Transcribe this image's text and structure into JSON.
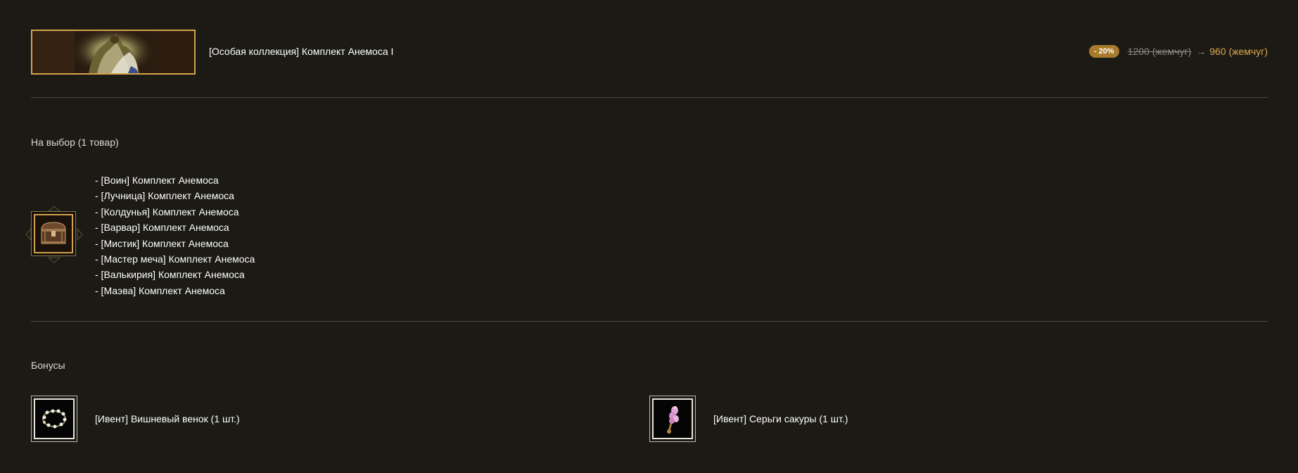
{
  "product": {
    "banner_icon": "anemos-costume-banner",
    "title": "[Особая коллекция] Комплект Анемоса I",
    "discount": "- 20%",
    "old_price": "1200 (жемчуг)",
    "arrow": "→",
    "new_price": "960 (жемчуг)"
  },
  "choice": {
    "heading": "На выбор (1 товар)",
    "icon": "treasure-chest-icon",
    "items": [
      "- [Воин] Комплект Анемоса",
      "- [Лучница] Комплект Анемоса",
      "- [Колдунья] Комплект Анемоса",
      "- [Варвар] Комплект Анемоса",
      "- [Мистик] Комплект Анемоса",
      "- [Мастер меча] Комплект Анемоса",
      "- [Валькирия] Комплект Анемоса",
      "- [Маэва] Комплект Анемоса"
    ]
  },
  "bonuses": {
    "heading": "Бонусы",
    "items": [
      {
        "icon": "flower-wreath-icon",
        "label": "[Ивент] Вишневый венок (1 шт.)"
      },
      {
        "icon": "sakura-earring-icon",
        "label": "[Ивент] Серьги сакуры (1 шт.)"
      }
    ]
  },
  "colors": {
    "background": "#1b1a14",
    "accent_gold": "#d4a24c",
    "price_highlight": "#e2a84e",
    "badge": "#a87a2b"
  }
}
